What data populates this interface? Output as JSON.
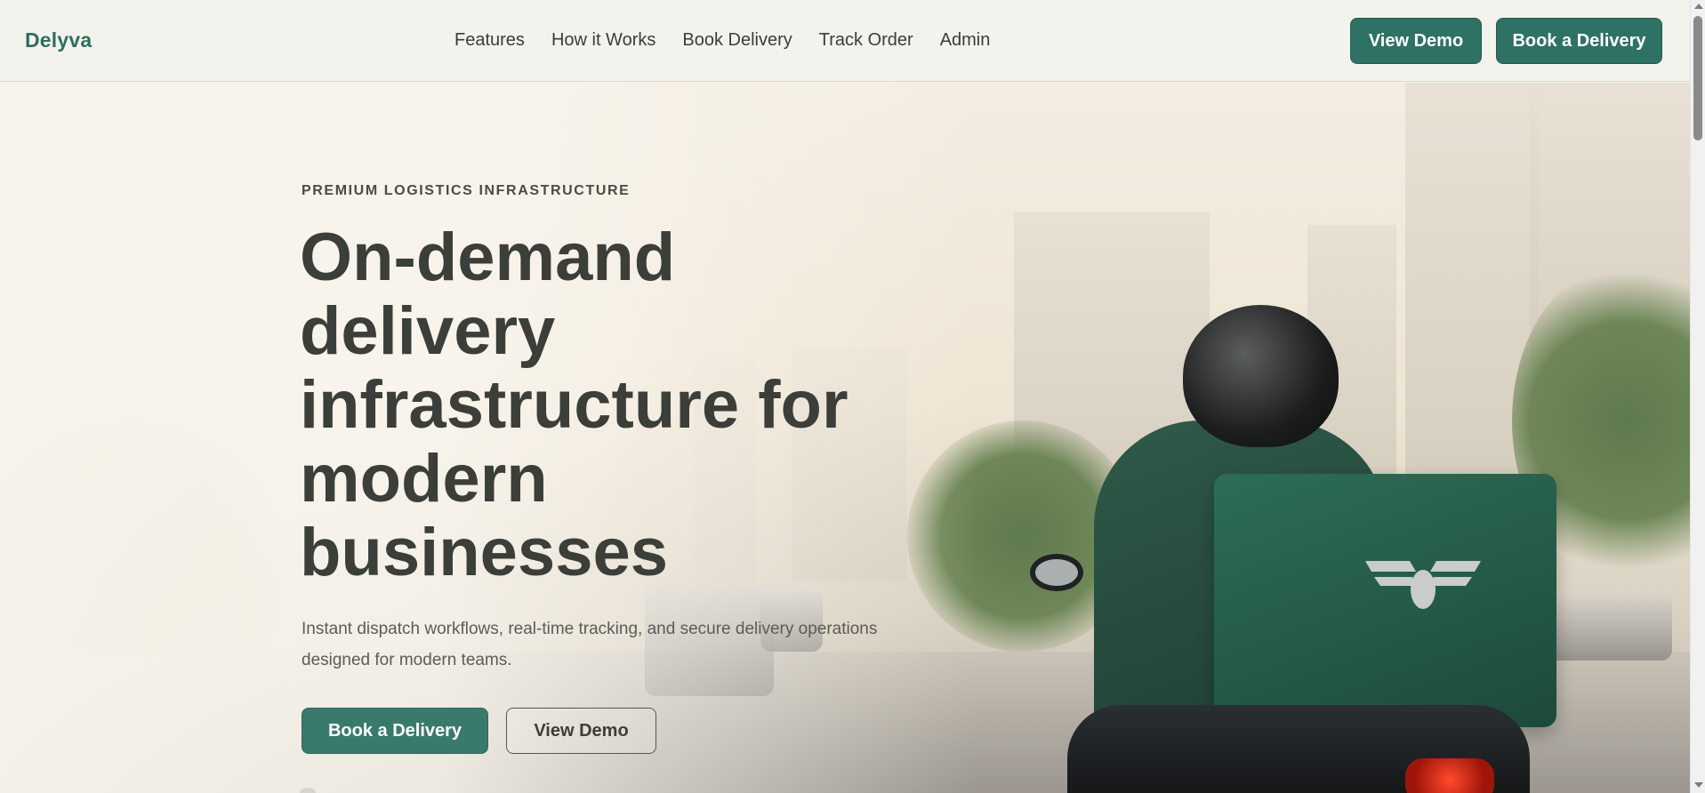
{
  "header": {
    "logo": "Delyva",
    "nav": [
      "Features",
      "How it Works",
      "Book Delivery",
      "Track Order",
      "Admin"
    ],
    "view_demo_label": "View Demo",
    "book_delivery_label": "Book a Delivery"
  },
  "hero": {
    "eyebrow": "PREMIUM LOGISTICS INFRASTRUCTURE",
    "title": "On-demand delivery infrastructure for modern businesses",
    "subtitle": "Instant dispatch workflows, real-time tracking, and secure delivery operations designed for modern teams.",
    "book_delivery_label": "Book a Delivery",
    "view_demo_label": "View Demo",
    "image_alt": "Delivery rider on scooter with green insulated box in city street"
  },
  "colors": {
    "brand": "#2e7265",
    "text_dark": "#3b3e39",
    "header_bg": "#f4f2ed"
  },
  "icons": {
    "scroll_up": "scroll-up-arrow-icon",
    "scroll_down": "scroll-down-arrow-icon",
    "box_logo": "wing-logo-icon"
  }
}
